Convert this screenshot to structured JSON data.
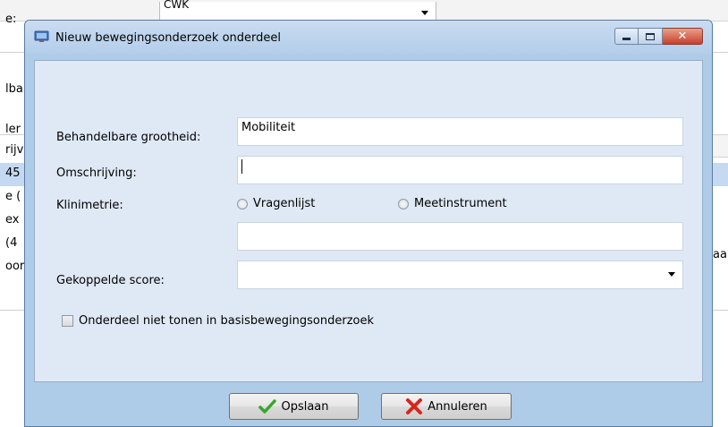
{
  "background": {
    "combo_value": "CWK",
    "label_top": "e:",
    "fragments": [
      "lba",
      "ler",
      "rijv",
      "45",
      "e (",
      "ex",
      "(4",
      "oor"
    ],
    "right_fragment": "aan"
  },
  "dialog": {
    "title": "Nieuw bewegingsonderzoek onderdeel",
    "fields": {
      "behandelbare_label": "Behandelbare grootheid:",
      "behandelbare_value": "Mobiliteit",
      "omschrijving_label": "Omschrijving:",
      "omschrijving_value": "",
      "klinimetrie_label": "Klinimetrie:",
      "radio_vragenlijst": "Vragenlijst",
      "radio_meetinstrument": "Meetinstrument",
      "klinimetrie_value": "",
      "gekoppelde_label": "Gekoppelde score:",
      "gekoppelde_value": ""
    },
    "checkbox_label": "Onderdeel niet tonen in basisbewegingsonderzoek",
    "buttons": {
      "save": "Opslaan",
      "cancel": "Annuleren"
    }
  },
  "colors": {
    "accent": "#aecbe8",
    "client": "#dfe9f5",
    "selected_row": "#c5d9f1",
    "save_icon": "#3aa52c",
    "cancel_icon": "#d8261c"
  }
}
